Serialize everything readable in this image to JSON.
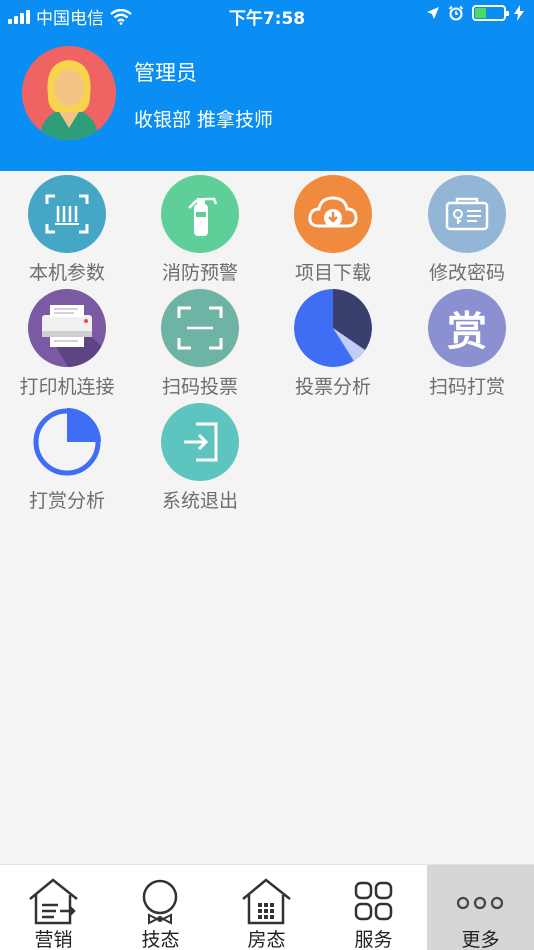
{
  "status_bar": {
    "carrier": "中国电信",
    "time": "下午7:58"
  },
  "profile": {
    "name": "管理员",
    "role": "收银部 推拿技师"
  },
  "menu": {
    "items": [
      {
        "label": "本机参数",
        "icon": "scan-frame-icon",
        "color": "#45a6c6"
      },
      {
        "label": "消防预警",
        "icon": "fire-extinguisher-icon",
        "color": "#5fcf9a"
      },
      {
        "label": "项目下载",
        "icon": "cloud-download-icon",
        "color": "#ef8a3f"
      },
      {
        "label": "修改密码",
        "icon": "key-card-icon",
        "color": "#94b6d6"
      },
      {
        "label": "打印机连接",
        "icon": "printer-icon",
        "color": "#7a5ba3"
      },
      {
        "label": "扫码投票",
        "icon": "scan-qr-icon",
        "color": "#6fb3a4"
      },
      {
        "label": "投票分析",
        "icon": "pie-chart-icon",
        "color": "#3f6ef5"
      },
      {
        "label": "扫码打赏",
        "icon": "reward-icon",
        "color": "#8b90d0",
        "glyph": "赏"
      },
      {
        "label": "打赏分析",
        "icon": "progress-ring-icon",
        "color": "#3f6ef5"
      },
      {
        "label": "系统退出",
        "icon": "logout-icon",
        "color": "#5ec4bf"
      }
    ]
  },
  "tabbar": {
    "tabs": [
      {
        "label": "营销",
        "icon": "house-list-icon"
      },
      {
        "label": "技态",
        "icon": "bowtie-person-icon"
      },
      {
        "label": "房态",
        "icon": "house-grid-icon"
      },
      {
        "label": "服务",
        "icon": "apps-grid-icon"
      },
      {
        "label": "更多",
        "icon": "more-dots-icon"
      }
    ],
    "active": "更多"
  }
}
